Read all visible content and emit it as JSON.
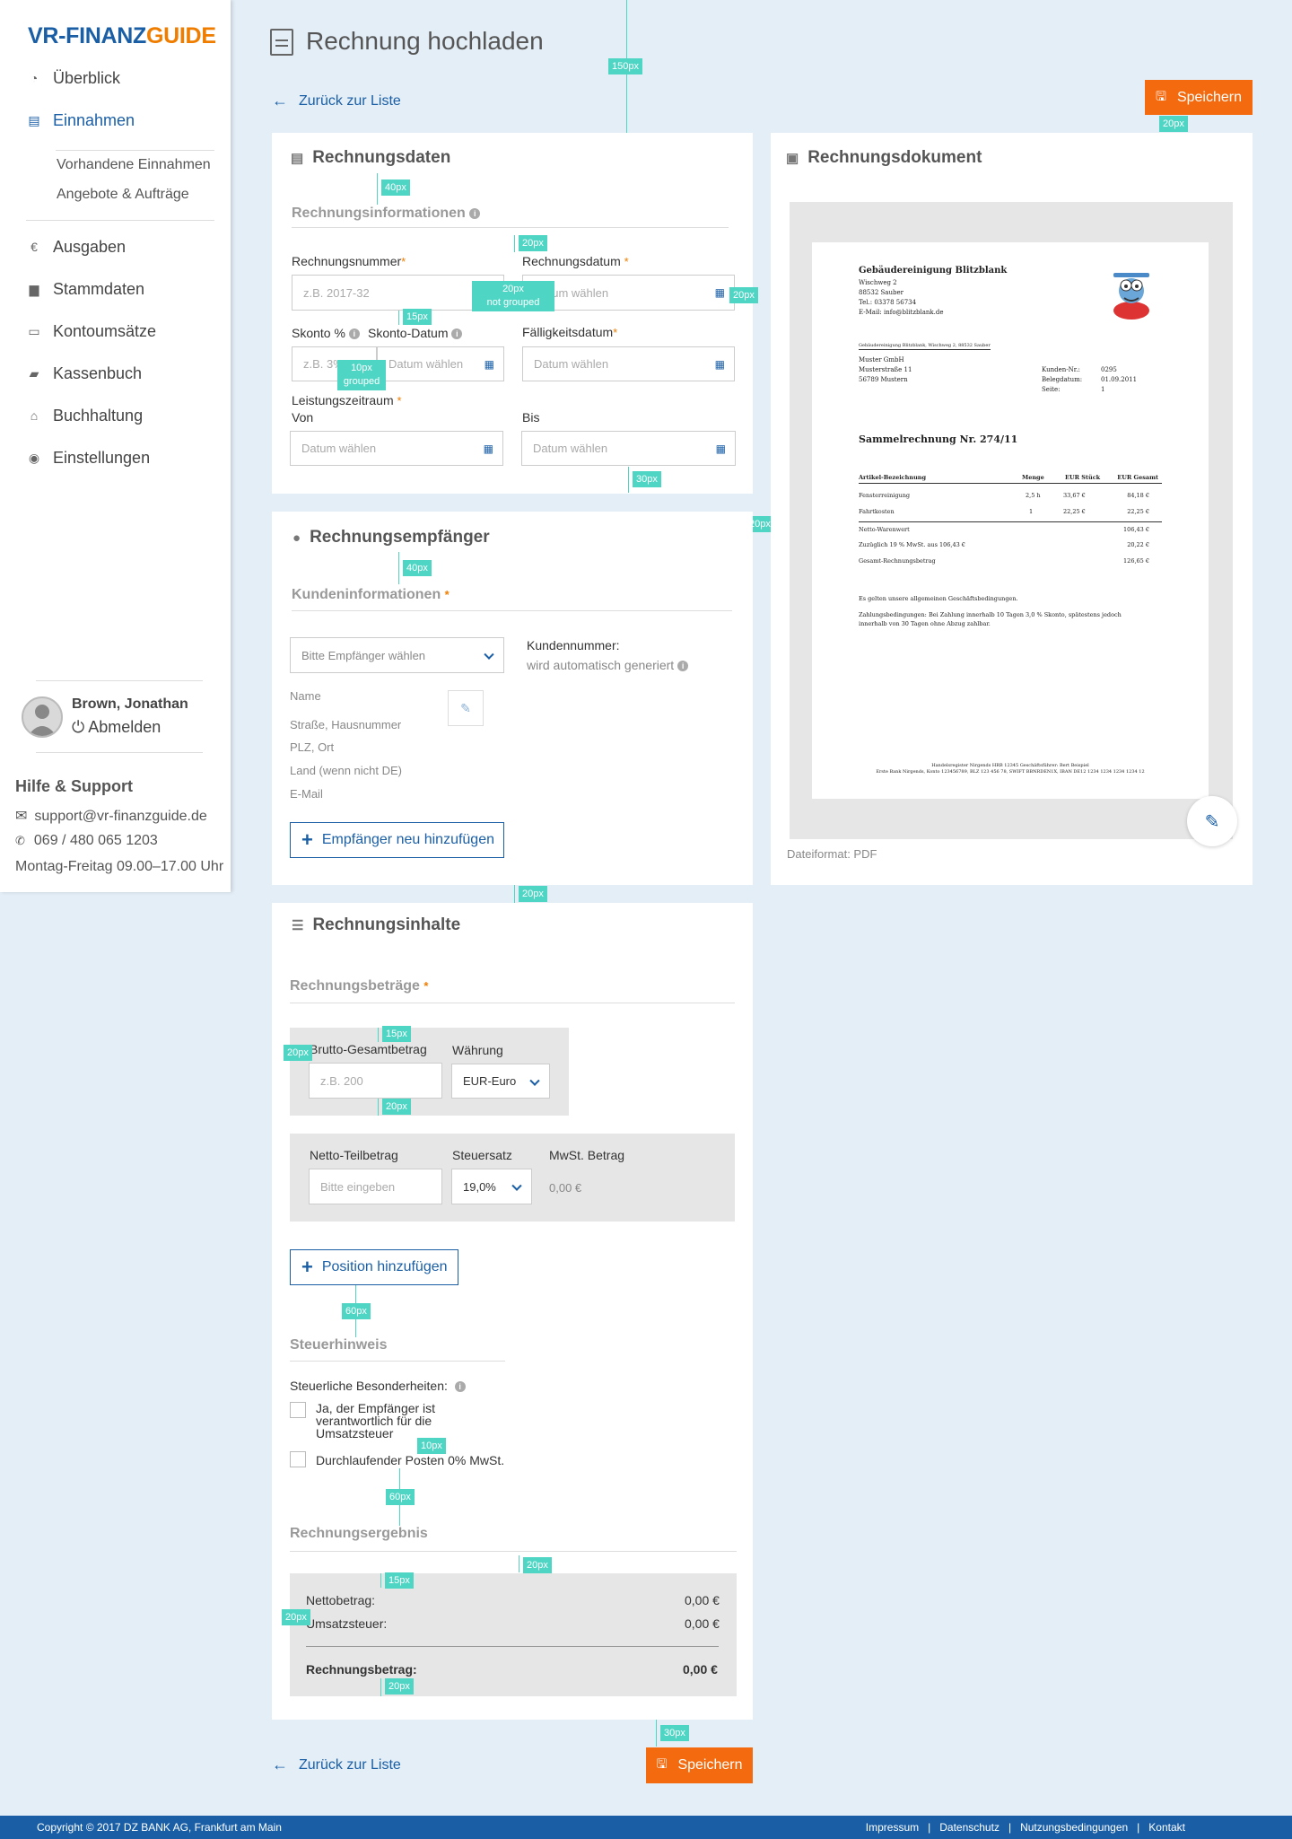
{
  "brand": {
    "part1": "VR-FINANZ",
    "part2": "GUIDE"
  },
  "nav": {
    "overview": "Überblick",
    "income": "Einnahmen",
    "income_sub": [
      "Vorhandene Einnahmen",
      "Angebote & Aufträge"
    ],
    "expenses": "Ausgaben",
    "master": "Stammdaten",
    "accounts": "Kontoumsätze",
    "cashbook": "Kassenbuch",
    "accounting": "Buchhaltung",
    "settings": "Einstellungen"
  },
  "user": {
    "name": "Brown, Jonathan",
    "logout": "Abmelden"
  },
  "help": {
    "title": "Hilfe & Support",
    "email": "support@vr-finanzguide.de",
    "phone": "069 / 480 065 1203",
    "hours": "Montag-Freitag 09.00–17.00 Uhr"
  },
  "page": {
    "title": "Rechnung hochladen",
    "back": "Zurück zur Liste",
    "save": "Speichern"
  },
  "invoice_data": {
    "title": "Rechnungsdaten",
    "section": "Rechnungsinformationen",
    "number_label": "Rechnungsnummer",
    "number_placeholder": "z.B. 2017-32",
    "date_label": "Rechnungsdatum",
    "date_placeholder": "Datum wählen",
    "skonto_label": "Skonto %",
    "skonto_placeholder": "z.B. 3%",
    "skonto_date_label": "Skonto-Datum",
    "skonto_date_placeholder": "Datum wählen",
    "due_label": "Fälligkeitsdatum",
    "due_placeholder": "Datum wählen",
    "period_label": "Leistungszeitraum",
    "from_label": "Von",
    "from_placeholder": "Datum wählen",
    "to_label": "Bis",
    "to_placeholder": "Datum wählen"
  },
  "recipient": {
    "title": "Rechnungsempfänger",
    "section": "Kundeninformationen",
    "select_placeholder": "Bitte Empfänger wählen",
    "customer_number_label": "Kundennummer:",
    "customer_number_value": "wird automatisch generiert",
    "fields": [
      "Name",
      "Straße, Hausnummer",
      "PLZ, Ort",
      "Land (wenn nicht DE)",
      "E-Mail"
    ],
    "add": "Empfänger neu hinzufügen"
  },
  "contents": {
    "title": "Rechnungsinhalte",
    "section": "Rechnungsbeträge",
    "gross_label": "Brutto-Gesamtbetrag",
    "gross_placeholder": "z.B. 200",
    "currency_label": "Währung",
    "currency_value": "EUR-Euro",
    "net_label": "Netto-Teilbetrag",
    "net_placeholder": "Bitte eingeben",
    "tax_label": "Steuersatz",
    "tax_value": "19,0%",
    "vat_label": "MwSt. Betrag",
    "vat_value": "0,00 €",
    "add_position": "Position hinzufügen",
    "tax_section": "Steuerhinweis",
    "tax_special": "Steuerliche Besonderheiten:",
    "check1": "Ja, der Empfänger ist verantwortlich für die Umsatzsteuer",
    "check2": "Durchlaufender Posten 0% MwSt.",
    "result_section": "Rechnungsergebnis",
    "net_amount_label": "Nettobetrag:",
    "net_amount": "0,00 €",
    "vat_amount_label": "Umsatzsteuer:",
    "vat_amount": "0,00 €",
    "total_label": "Rechnungsbetrag:",
    "total": "0,00 €"
  },
  "document": {
    "title": "Rechnungsdokument",
    "format": "Dateiformat: PDF",
    "company": "Gebäudereinigung Blitzblank",
    "c_street": "Wischweg 2",
    "c_city": "88532 Sauber",
    "c_tel": "Tel.: 03378 56734",
    "c_mail": "E-Mail: info@blitzblank.de",
    "sender_line": "Gebäudereinigung Blitzblank, Wischweg 2, 88532 Sauber",
    "r_name": "Muster GmbH",
    "r_street": "Musterstraße 11",
    "r_city": "56789 Mustern",
    "kd_label": "Kunden-Nr.:",
    "kd_value": "0295",
    "bd_label": "Belegdatum:",
    "bd_value": "01.09.2011",
    "page_label": "Seite:",
    "page_value": "1",
    "heading": "Sammelrechnung Nr. 274/11",
    "th": [
      "Artikel-Bezeichnung",
      "Menge",
      "EUR Stück",
      "EUR Gesamt"
    ],
    "rows": [
      [
        "Fensterreinigung",
        "2,5 h",
        "33,67 €",
        "84,18 €"
      ],
      [
        "Fahrtkosten",
        "1",
        "22,25 €",
        "22,25 €"
      ]
    ],
    "net_label": "Netto-Warenwert",
    "net_value": "106,43 €",
    "vat_label": "Zuzüglich 19 % MwSt. aus 106,43 €",
    "vat_value": "20,22 €",
    "total_label": "Gesamt-Rechnungsbetrag",
    "total_value": "126,65 €",
    "note1": "Es gelten unsere allgemeinen Geschäftsbedingungen.",
    "note2": "Zahlungsbedingungen: Bei Zahlung innerhalb 10 Tagen 3,0 % Skonto, spätestens jedoch innerhalb von 30 Tagen ohne Abzug zahlbar.",
    "foot1": "Handelsregister Nirgends HRB 12345 Geschäftsführer: Bert Beispiel",
    "foot2": "Erste Bank Nirgends, Konto 123456789, BLZ 123 456 78, SWIFT BBNRDEN1X, IBAN DE12 1234 1234 1234 1234 12"
  },
  "annotations": {
    "a150": "150px",
    "a20": "20px",
    "a40": "40px",
    "a15": "15px",
    "a10": "10px",
    "a30": "30px",
    "a60": "60px",
    "not_grouped": "not grouped",
    "grouped": "grouped"
  },
  "footer": {
    "copyright": "Copyright © 2017 DZ BANK AG, Frankfurt am Main",
    "links": [
      "Impressum",
      "Datenschutz",
      "Nutzungsbedingungen",
      "Kontakt"
    ]
  },
  "colors": {
    "primary": "#1a5fa6",
    "accent": "#ef7d00",
    "save": "#f36a0f",
    "annotation": "#4fd5c4",
    "background": "#e4eef7"
  }
}
